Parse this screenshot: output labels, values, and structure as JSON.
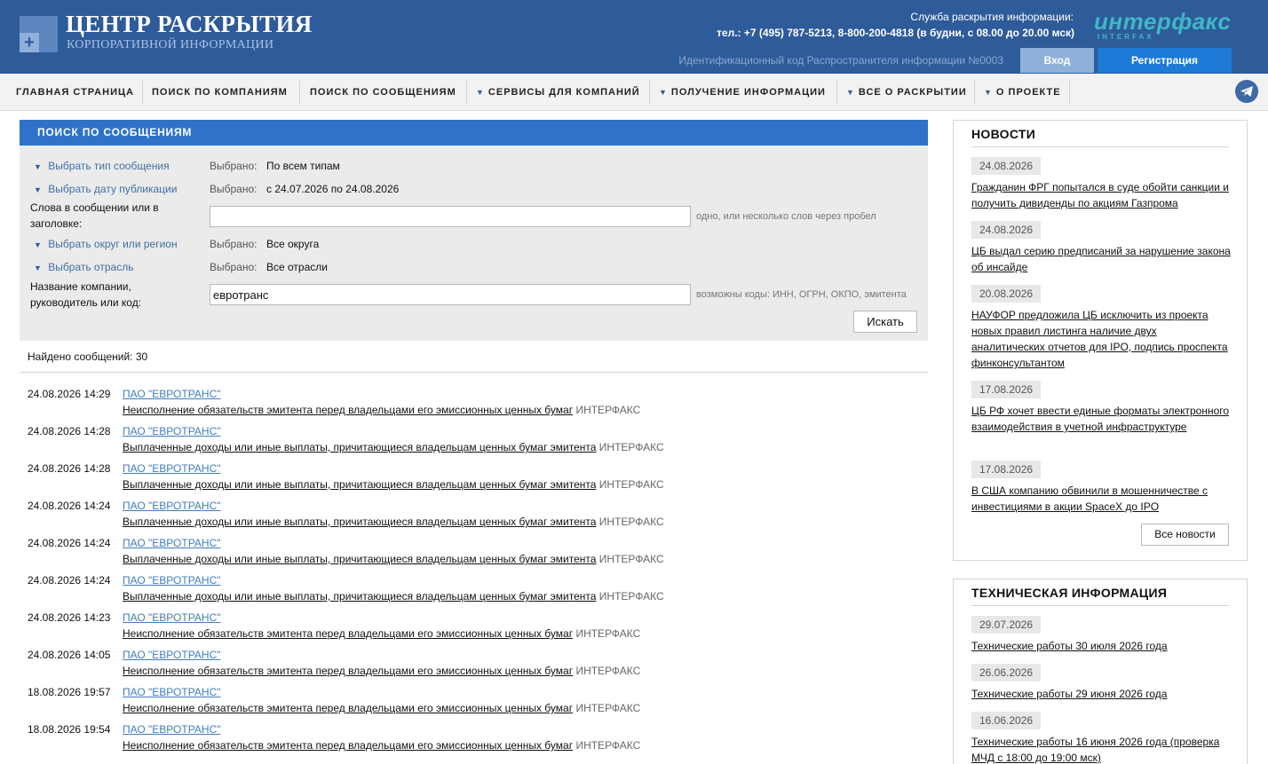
{
  "header": {
    "title": "ЦЕНТР РАСКРЫТИЯ",
    "subtitle": "КОРПОРАТИВНОЙ ИНФОРМАЦИИ",
    "service_label": "Служба раскрытия информации:",
    "phones": "тел.: +7 (495) 787-5213, 8-800-200-4818 (в будни, с 08.00 до 20.00 мск)",
    "brand": "интерфакс",
    "brand_sub": "INTERFAX",
    "ident": "Идентификационный код Распространителя информации №0003",
    "login_label": "Вход",
    "register_label": "Регистрация"
  },
  "nav": {
    "items": [
      {
        "label": "ГЛАВНАЯ СТРАНИЦА"
      },
      {
        "label": "ПОИСК ПО КОМПАНИЯМ"
      },
      {
        "label": "ПОИСК ПО СООБЩЕНИЯМ"
      },
      {
        "label": "СЕРВИСЫ ДЛЯ КОМПАНИЙ"
      },
      {
        "label": "ПОЛУЧЕНИЕ ИНФОРМАЦИИ"
      },
      {
        "label": "ВСЕ О РАСКРЫТИИ"
      },
      {
        "label": "О ПРОЕКТЕ"
      }
    ],
    "telegram_icon": "telegram-icon"
  },
  "search": {
    "title": "ПОИСК ПО СООБЩЕНИЯМ",
    "selected_label": "Выбрано:",
    "type_link": "Выбрать тип сообщения",
    "type_value": "По всем типам",
    "date_link": "Выбрать дату публикации",
    "date_value": "с 24.07.2026 по 24.08.2026",
    "words_label": "Слова в сообщении или в заголовке:",
    "words_value": "",
    "words_hint": "одно, или несколько слов через пробел",
    "region_link": "Выбрать округ или регион",
    "region_value": "Все округа",
    "industry_link": "Выбрать отрасль",
    "industry_value": "Все отрасли",
    "company_label": "Название компании, руководитель или код:",
    "company_value": "евротранс",
    "company_hint": "возможны коды: ИНН, ОГРН, ОКПО, эмитента",
    "search_button": "Искать"
  },
  "results": {
    "found": "Найдено сообщений: 30",
    "items": [
      {
        "date": "24.08.2026 14:29",
        "company": "ПАО \"ЕВРОТРАНС\"",
        "message": "Неисполнение обязательств эмитента перед владельцами его эмиссионных ценных бумаг",
        "source": "ИНТЕРФАКС"
      },
      {
        "date": "24.08.2026 14:28",
        "company": "ПАО \"ЕВРОТРАНС\"",
        "message": "Выплаченные доходы или иные выплаты, причитающиеся владельцам ценных бумаг эмитента",
        "source": "ИНТЕРФАКС"
      },
      {
        "date": "24.08.2026 14:28",
        "company": "ПАО \"ЕВРОТРАНС\"",
        "message": "Выплаченные доходы или иные выплаты, причитающиеся владельцам ценных бумаг эмитента",
        "source": "ИНТЕРФАКС"
      },
      {
        "date": "24.08.2026 14:24",
        "company": "ПАО \"ЕВРОТРАНС\"",
        "message": "Выплаченные доходы или иные выплаты, причитающиеся владельцам ценных бумаг эмитента",
        "source": "ИНТЕРФАКС"
      },
      {
        "date": "24.08.2026 14:24",
        "company": "ПАО \"ЕВРОТРАНС\"",
        "message": "Выплаченные доходы или иные выплаты, причитающиеся владельцам ценных бумаг эмитента",
        "source": "ИНТЕРФАКС"
      },
      {
        "date": "24.08.2026 14:24",
        "company": "ПАО \"ЕВРОТРАНС\"",
        "message": "Выплаченные доходы или иные выплаты, причитающиеся владельцам ценных бумаг эмитента",
        "source": "ИНТЕРФАКС"
      },
      {
        "date": "24.08.2026 14:23",
        "company": "ПАО \"ЕВРОТРАНС\"",
        "message": "Неисполнение обязательств эмитента перед владельцами его эмиссионных ценных бумаг",
        "source": "ИНТЕРФАКС"
      },
      {
        "date": "24.08.2026 14:05",
        "company": "ПАО \"ЕВРОТРАНС\"",
        "message": "Неисполнение обязательств эмитента перед владельцами его эмиссионных ценных бумаг",
        "source": "ИНТЕРФАКС"
      },
      {
        "date": "18.08.2026 19:57",
        "company": "ПАО \"ЕВРОТРАНС\"",
        "message": "Неисполнение обязательств эмитента перед владельцами его эмиссионных ценных бумаг",
        "source": "ИНТЕРФАКС"
      },
      {
        "date": "18.08.2026 19:54",
        "company": "ПАО \"ЕВРОТРАНС\"",
        "message": "Неисполнение обязательств эмитента перед владельцами его эмиссионных ценных бумаг",
        "source": "ИНТЕРФАКС"
      }
    ]
  },
  "news": {
    "title": "НОВОСТИ",
    "all_button": "Все новости",
    "items": [
      {
        "date": "24.08.2026",
        "text": "Гражданин ФРГ попытался в суде обойти санкции и получить дивиденды по акциям Газпрома"
      },
      {
        "date": "24.08.2026",
        "text": "ЦБ выдал серию предписаний за нарушение закона об инсайде"
      },
      {
        "date": "20.08.2026",
        "text": "НАУФОР предложила ЦБ исключить из проекта новых правил листинга наличие двух аналитических отчетов для IPO, подпись проспекта финконсультантом"
      },
      {
        "date": "17.08.2026",
        "text": "ЦБ РФ хочет ввести единые форматы электронного взаимодействия в учетной инфраструктуре"
      },
      {
        "date": "17.08.2026",
        "text": "В США компанию обвинили в мошенничестве с инвестициями в акции SpaceX до IPO"
      }
    ]
  },
  "tech": {
    "title": "ТЕХНИЧЕСКАЯ ИНФОРМАЦИЯ",
    "items": [
      {
        "date": "29.07.2026",
        "text": "Технические работы 30 июля 2026 года"
      },
      {
        "date": "26.06.2026",
        "text": "Технические работы 29 июня 2026 года"
      },
      {
        "date": "16.06.2026",
        "text": "Технические работы 16 июня 2026 года (проверка МЧД с 18:00 до 19:00 мск)"
      }
    ]
  }
}
